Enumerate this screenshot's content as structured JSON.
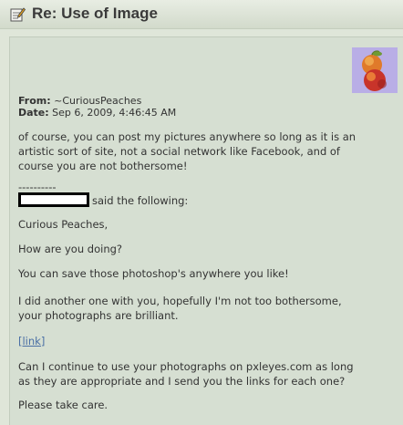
{
  "post": {
    "title": "Re: Use of Image",
    "from_label": "From:",
    "from_value": "~CuriousPeaches",
    "date_label": "Date:",
    "date_value": "Sep 6, 2009, 4:46:45 AM",
    "reply_lines": [
      "of course, you can post my pictures anywhere so long as it is an",
      "artistic sort of site, not a social network like Facebook, and of",
      "course you are not bothersome!"
    ],
    "divider": "----------",
    "said_following": "said the following:",
    "quoted": {
      "greeting": "Curious Peaches,",
      "line_how": "How are you doing?",
      "line_save": "You can save those photoshop's anywhere you like!",
      "line_another_1": "I did another one with you, hopefully I'm not too bothersome,",
      "line_another_2": "your photographs are brilliant.",
      "link_label": "[link]",
      "line_continue_1": "Can I continue to use your photographs on pxleyes.com as long",
      "line_continue_2": "as they are appropriate and I send you the links for each one?",
      "line_care": "Please take care."
    }
  },
  "icons": {
    "title_icon": "edit-note-icon",
    "avatar": "peaches-avatar"
  },
  "colors": {
    "background": "#d6dfd2",
    "title_bar": "#dfe6d9",
    "link": "#4a6fa5",
    "avatar_bg": "#b9aee6"
  }
}
